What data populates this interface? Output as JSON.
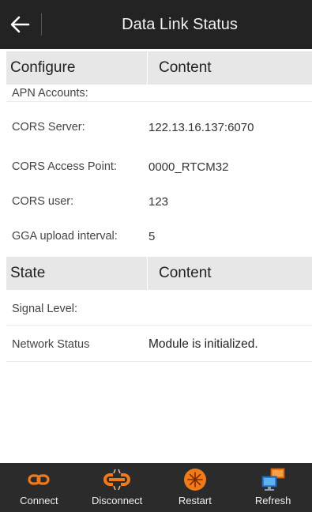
{
  "header": {
    "title": "Data Link Status"
  },
  "configure_section": {
    "col1": "Configure",
    "col2": "Content",
    "rows": [
      {
        "label": "APN Accounts:",
        "value": ""
      },
      {
        "label": "CORS Server:",
        "value": "122.13.16.137:6070"
      },
      {
        "label": "CORS Access Point:",
        "value": "0000_RTCM32"
      },
      {
        "label": "CORS user:",
        "value": "123"
      },
      {
        "label": "GGA upload interval:",
        "value": "5"
      }
    ]
  },
  "state_section": {
    "col1": "State",
    "col2": "Content",
    "rows": [
      {
        "label": "Signal Level:",
        "value": ""
      },
      {
        "label": "Network Status",
        "value": "Module is initialized."
      }
    ]
  },
  "toolbar": {
    "items": [
      {
        "label": "Connect",
        "icon": "link-icon"
      },
      {
        "label": "Disconnect",
        "icon": "broken-link-icon"
      },
      {
        "label": "Restart",
        "icon": "restart-icon"
      },
      {
        "label": "Refresh",
        "icon": "network-computers-icon"
      }
    ]
  },
  "colors": {
    "titlebar": "#232323",
    "toolbar": "#2b2b2b",
    "accent_orange": "#f07a1a",
    "header_bg": "#e7e7e7"
  }
}
